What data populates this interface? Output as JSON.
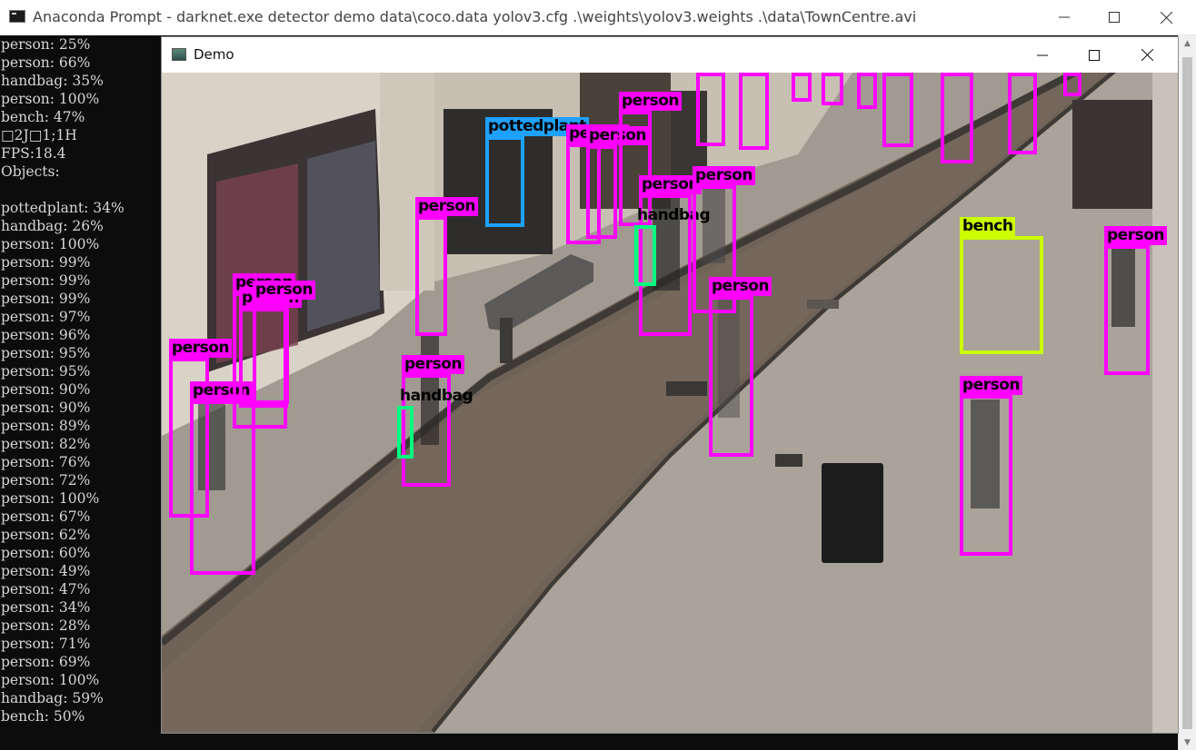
{
  "console_window": {
    "title": "Anaconda Prompt - darknet.exe  detector demo data\\coco.data yolov3.cfg .\\weights\\yolov3.weights .\\data\\TownCentre.avi",
    "output_lines": [
      "person: 25%",
      "person: 66%",
      "handbag: 35%",
      "person: 100%",
      "bench: 47%",
      "□2J□1;1H",
      "FPS:18.4",
      "Objects:",
      "",
      "pottedplant: 34%",
      "handbag: 26%",
      "person: 100%",
      "person: 99%",
      "person: 99%",
      "person: 99%",
      "person: 97%",
      "person: 96%",
      "person: 95%",
      "person: 95%",
      "person: 90%",
      "person: 90%",
      "person: 89%",
      "person: 82%",
      "person: 76%",
      "person: 72%",
      "person: 100%",
      "person: 67%",
      "person: 62%",
      "person: 60%",
      "person: 49%",
      "person: 47%",
      "person: 34%",
      "person: 28%",
      "person: 71%",
      "person: 69%",
      "person: 100%",
      "handbag: 59%",
      "bench: 50%"
    ]
  },
  "demo_window": {
    "title": "Demo"
  },
  "detections": [
    {
      "label": "person",
      "class": "person"
    },
    {
      "label": "person",
      "class": "person"
    },
    {
      "label": "person",
      "class": "person"
    },
    {
      "label": "person",
      "class": "person"
    },
    {
      "label": "person",
      "class": "person"
    },
    {
      "label": "person",
      "class": "person"
    },
    {
      "label": "person",
      "class": "person"
    },
    {
      "label": "handbag",
      "class": "bag"
    },
    {
      "label": "pottedplant",
      "class": "plant"
    },
    {
      "label": "person",
      "class": "person"
    },
    {
      "label": "person",
      "class": "person"
    },
    {
      "label": "person",
      "class": "person"
    },
    {
      "label": "person",
      "class": "person"
    },
    {
      "label": "handbag",
      "class": "bag"
    },
    {
      "label": "person",
      "class": "person"
    },
    {
      "label": "person",
      "class": "person"
    },
    {
      "label": "bench",
      "class": "bench"
    },
    {
      "label": "person",
      "class": "person"
    },
    {
      "label": "person",
      "class": "person"
    },
    {
      "label": "person",
      "class": "person"
    },
    {
      "label": "",
      "class": "person"
    },
    {
      "label": "",
      "class": "person"
    },
    {
      "label": "",
      "class": "person"
    },
    {
      "label": "",
      "class": "person"
    },
    {
      "label": "pe",
      "class": "person"
    },
    {
      "label": "person",
      "class": "person"
    },
    {
      "label": "",
      "class": "person"
    },
    {
      "label": "",
      "class": "person"
    }
  ],
  "colors": {
    "person_box": "#ff00ff",
    "plant_box": "#1ea1ff",
    "handbag_box": "#00ff7f",
    "bench_box": "#ccff00",
    "console_bg": "#0c0c0c"
  }
}
